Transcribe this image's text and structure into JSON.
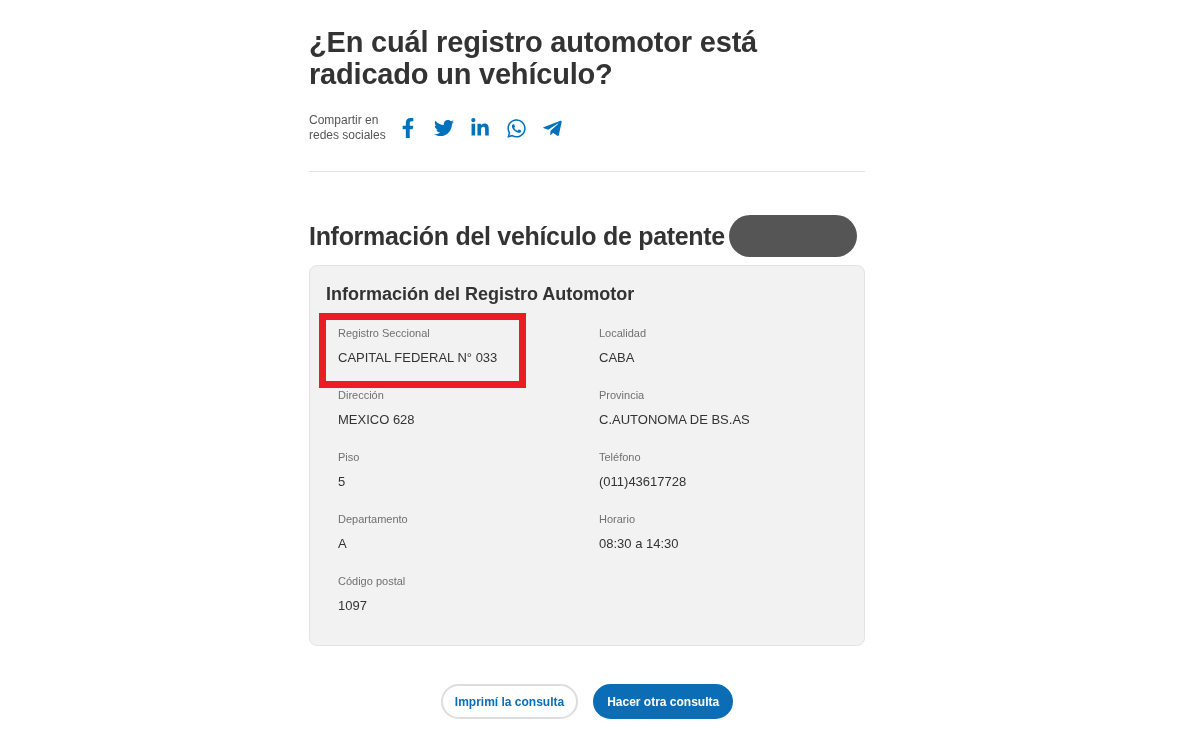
{
  "page": {
    "title": "¿En cuál registro automotor está radicado un vehículo?"
  },
  "share": {
    "label": "Compartir en redes sociales",
    "links": [
      {
        "kind": "facebook"
      },
      {
        "kind": "twitter"
      },
      {
        "kind": "linkedin"
      },
      {
        "kind": "whatsapp"
      },
      {
        "kind": "telegram"
      }
    ]
  },
  "vehicle": {
    "heading": "Información del vehículo de patente",
    "plate_redacted": true
  },
  "registry_card": {
    "title": "Información del Registro Automotor",
    "fields": [
      {
        "label": "Registro Seccional",
        "value": "CAPITAL FEDERAL N° 033",
        "highlighted": true
      },
      {
        "label": "Localidad",
        "value": "CABA",
        "highlighted": false
      },
      {
        "label": "Dirección",
        "value": "MEXICO 628",
        "highlighted": false
      },
      {
        "label": "Provincia",
        "value": "C.AUTONOMA DE BS.AS",
        "highlighted": false
      },
      {
        "label": "Piso",
        "value": "5",
        "highlighted": false
      },
      {
        "label": "Teléfono",
        "value": "(011)43617728",
        "highlighted": false
      },
      {
        "label": "Departamento",
        "value": "A",
        "highlighted": false
      },
      {
        "label": "Horario",
        "value": "08:30 a 14:30",
        "highlighted": false
      },
      {
        "label": "Código postal",
        "value": "1097",
        "highlighted": false
      }
    ]
  },
  "buttons": [
    {
      "label": "Imprimí la consulta",
      "kind": "outline"
    },
    {
      "label": "Hacer otra consulta",
      "kind": "primary"
    }
  ]
}
